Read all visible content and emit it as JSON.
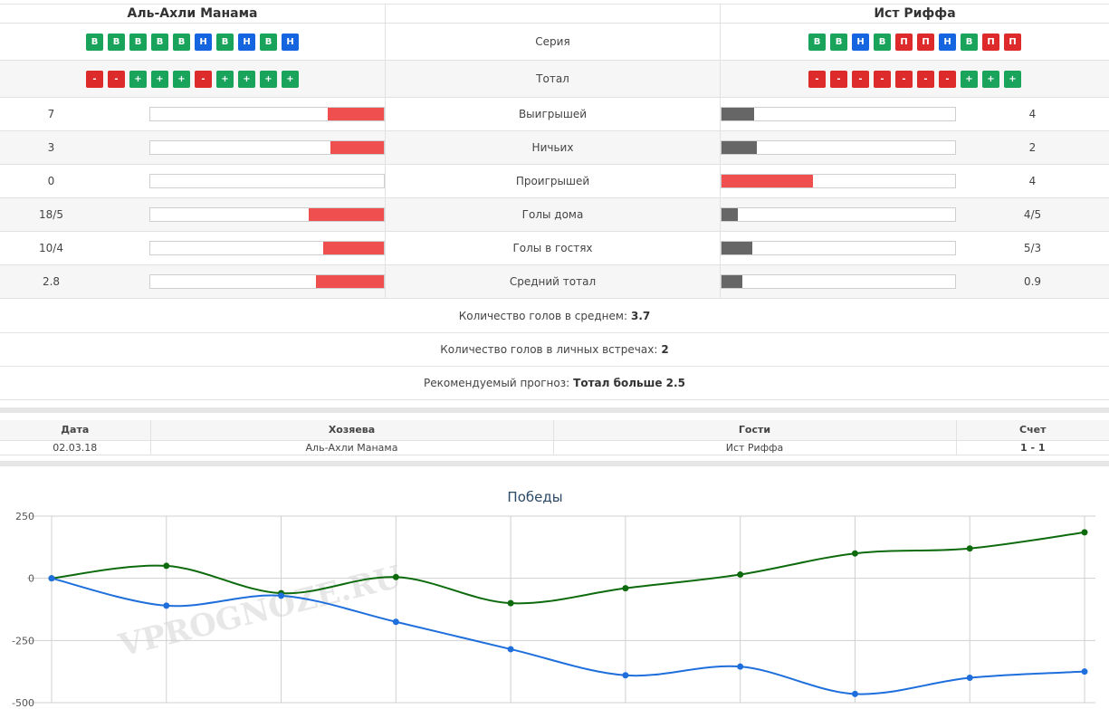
{
  "teams": {
    "home": "Аль-Ахли Манама",
    "away": "Ист Риффа"
  },
  "series": {
    "label": "Серия",
    "home": [
      "В",
      "В",
      "В",
      "В",
      "В",
      "Н",
      "В",
      "Н",
      "В",
      "Н"
    ],
    "away": [
      "В",
      "В",
      "Н",
      "В",
      "П",
      "П",
      "Н",
      "В",
      "П",
      "П"
    ]
  },
  "total": {
    "label": "Тотал",
    "home": [
      "-",
      "-",
      "+",
      "+",
      "+",
      "-",
      "+",
      "+",
      "+",
      "+"
    ],
    "away": [
      "-",
      "-",
      "-",
      "-",
      "-",
      "-",
      "-",
      "+",
      "+",
      "+"
    ]
  },
  "stats": [
    {
      "label": "Выигрышей",
      "home": "7",
      "away": "4",
      "home_share": 0.24,
      "away_share": 0.14,
      "away_color": "grey"
    },
    {
      "label": "Ничьих",
      "home": "3",
      "away": "2",
      "home_share": 0.23,
      "away_share": 0.15,
      "away_color": "grey"
    },
    {
      "label": "Проигрышей",
      "home": "0",
      "away": "4",
      "home_share": 0.0,
      "away_share": 0.39,
      "away_color": "red"
    },
    {
      "label": "Голы дома",
      "home": "18/5",
      "away": "4/5",
      "home_share": 0.32,
      "away_share": 0.07,
      "away_color": "grey"
    },
    {
      "label": "Голы в гостях",
      "home": "10/4",
      "away": "5/3",
      "home_share": 0.26,
      "away_share": 0.13,
      "away_color": "grey"
    },
    {
      "label": "Средний тотал",
      "home": "2.8",
      "away": "0.9",
      "home_share": 0.29,
      "away_share": 0.09,
      "away_color": "grey"
    }
  ],
  "summary": {
    "avg_goals_label": "Количество голов в среднем:",
    "avg_goals_value": "3.7",
    "h2h_goals_label": "Количество голов в личных встречах:",
    "h2h_goals_value": "2",
    "forecast_label": "Рекомендуемый прогноз:",
    "forecast_value": "Тотал больше 2.5"
  },
  "h2h": {
    "headers": [
      "Дата",
      "Хозяева",
      "Гости",
      "Счет"
    ],
    "rows": [
      {
        "date": "02.03.18",
        "home": "Аль-Ахли Манама",
        "away": "Ист Риффа",
        "score": "1 - 1"
      }
    ]
  },
  "colors": {
    "green": "#1aa35a",
    "blue": "#1565e0",
    "red": "#dd2a2a",
    "bar_red": "#ef4f4f",
    "bar_grey": "#666666",
    "line_home": "#0d6b0d",
    "line_away": "#1e6fdc"
  },
  "chart_data": {
    "type": "line",
    "title": "Победы",
    "ylim": [
      -500,
      250
    ],
    "yticks": [
      250,
      0,
      -250,
      -500
    ],
    "x": [
      0,
      1,
      2,
      3,
      4,
      5,
      6,
      7,
      8,
      9
    ],
    "series": [
      {
        "values": [
          0,
          50,
          -60,
          5,
          -100,
          -40,
          15,
          100,
          120,
          185
        ],
        "color": "#0d6b0d"
      },
      {
        "values": [
          0,
          -110,
          -70,
          -175,
          -285,
          -390,
          -355,
          -465,
          -400,
          -375
        ],
        "color": "#1e6fdc"
      }
    ],
    "grid": true,
    "watermark": "VPROGNOZE.RU"
  }
}
